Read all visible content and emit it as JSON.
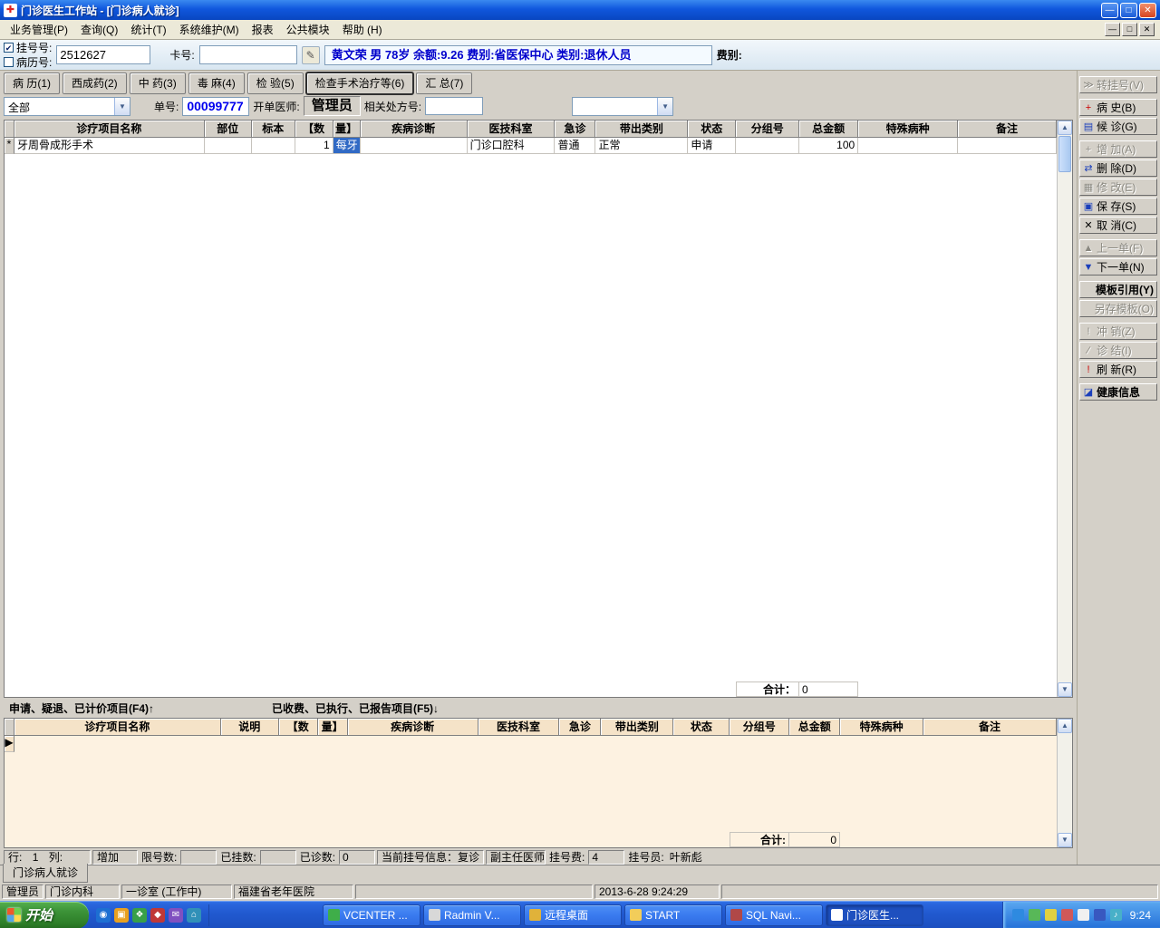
{
  "titlebar": {
    "title": "门诊医生工作站  -  [门诊病人就诊]"
  },
  "window_controls": {
    "minimize": "—",
    "restore": "□",
    "close": "✕"
  },
  "menu": {
    "items": [
      "业务管理(P)",
      "查询(Q)",
      "统计(T)",
      "系统维护(M)",
      "报表",
      "公共模块",
      "帮助 (H)"
    ]
  },
  "icons": {
    "app": "✚",
    "dropdown_arrow": "▼",
    "scroll_up": "▲",
    "scroll_down": "▼",
    "check": "✔",
    "card_edit": "✎"
  },
  "patient": {
    "reg_label": "挂号号:",
    "record_label": "病历号:",
    "reg_no": "2512627",
    "card_label": "卡号:",
    "card_no": "",
    "info": "黄文荣 男  78岁  余额:9.26  费别:省医保中心  类别:退休人员",
    "fee_label": "费别:"
  },
  "tabs": {
    "items": [
      "病 历(1)",
      "西成药(2)",
      "中 药(3)",
      "毒 麻(4)",
      "检 验(5)",
      "检查手术治疗等(6)",
      "汇 总(7)"
    ]
  },
  "filter": {
    "scope": "全部",
    "order_label": "单号:",
    "order_no": "00099777",
    "doctor_label": "开单医师:",
    "doctor": "管理员",
    "rx_label": "相关处方号:",
    "rx_no": "",
    "combo2": ""
  },
  "upper_grid": {
    "headers": [
      "诊疗项目名称",
      "部位",
      "标本",
      "【数",
      "量】",
      "疾病诊断",
      "医技科室",
      "急诊",
      "带出类别",
      "状态",
      "分组号",
      "总金额",
      "特殊病种",
      "备注"
    ],
    "row_marker": "*",
    "row": {
      "name": "牙周骨成形手术",
      "part": "",
      "specimen": "",
      "qty": "1",
      "unit": "每牙",
      "diagnosis": "",
      "dept": "门诊口腔科",
      "emergency": "普通",
      "carry": "正常",
      "status": "申请",
      "group": "",
      "amount": "100",
      "special": "",
      "remark": ""
    },
    "total_label": "合计：",
    "total_value": "0"
  },
  "section": {
    "left": "申请、疑退、已计价项目(F4)↑",
    "right": "已收费、已执行、已报告项目(F5)↓"
  },
  "lower_grid": {
    "headers": [
      "诊疗项目名称",
      "说明",
      "【数",
      "量】",
      "疾病诊断",
      "医技科室",
      "急诊",
      "带出类别",
      "状态",
      "分组号",
      "总金额",
      "特殊病种",
      "备注"
    ],
    "row_marker": "▶",
    "total_label": "合计:",
    "total_value": "0"
  },
  "sidebar": {
    "buttons": [
      {
        "icon": "≫",
        "label": "转挂号(V)"
      },
      {
        "icon": "+",
        "label": "病  史(B)"
      },
      {
        "icon": "▤",
        "label": "候  诊(G)"
      },
      {
        "icon": "+",
        "label": "增  加(A)"
      },
      {
        "icon": "⇄",
        "label": "删  除(D)"
      },
      {
        "icon": "▦",
        "label": "修  改(E)"
      },
      {
        "icon": "▣",
        "label": "保  存(S)"
      },
      {
        "icon": "✕",
        "label": "取  消(C)"
      },
      {
        "icon": "▲",
        "label": "上一单(F)"
      },
      {
        "icon": "▼",
        "label": "下一单(N)"
      },
      {
        "icon": "",
        "label": "模板引用(Y)"
      },
      {
        "icon": "",
        "label": "另存模板(O)"
      },
      {
        "icon": "!",
        "label": "冲  销(Z)"
      },
      {
        "icon": "∕",
        "label": "诊  结(I)"
      },
      {
        "icon": "!",
        "label": "刷  新(R)"
      },
      {
        "icon": "◪",
        "label": "健康信息"
      }
    ]
  },
  "status1": {
    "row_label": "行:",
    "row_value": "1",
    "col_label": "列:",
    "mode": "增加",
    "limit_label": "限号数:",
    "limit_value": "",
    "registered_label": "已挂数:",
    "registered_value": "",
    "seen_label": "已诊数:",
    "seen_value": "0",
    "current_info": "当前挂号信息：复诊",
    "doctor_title": "副主任医师",
    "reg_fee_label": "挂号费:",
    "reg_fee_value": "4",
    "registrar_label": "挂号员:",
    "registrar_value": "叶新彪"
  },
  "doc_tab": "门诊病人就诊",
  "status2": {
    "user": "管理员",
    "dept": "门诊内科",
    "room": "一诊室 (工作中)",
    "hospital": "福建省老年医院",
    "datetime": "2013-6-28 9:24:29"
  },
  "taskbar": {
    "start": "开始",
    "tasks": [
      {
        "label": "VCENTER ..."
      },
      {
        "label": "Radmin V..."
      },
      {
        "label": "远程桌面"
      },
      {
        "label": "START"
      },
      {
        "label": "SQL Navi..."
      },
      {
        "label": "门诊医生..."
      }
    ],
    "time": "9:24"
  }
}
